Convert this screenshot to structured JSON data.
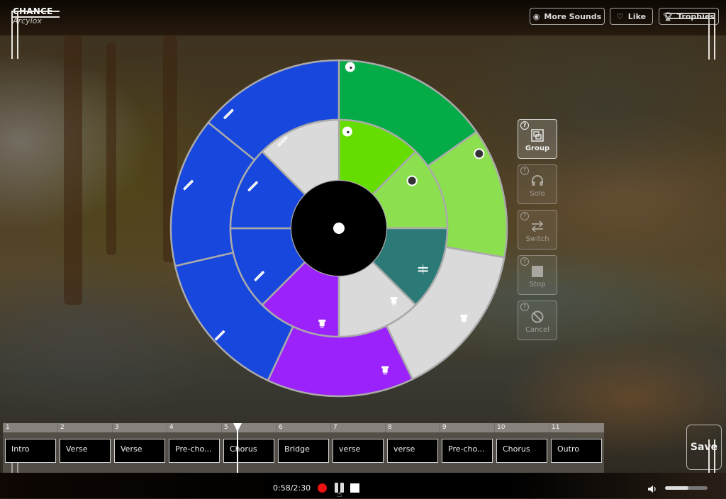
{
  "app": {
    "title": "CHANCE",
    "subtitle": "Arcylox"
  },
  "header": {
    "buttons": [
      {
        "label": "More Sounds",
        "icon": "disc-icon"
      },
      {
        "label": "Like",
        "icon": "heart-icon"
      },
      {
        "label": "Trophies",
        "icon": "trophy-icon"
      }
    ]
  },
  "wheel": {
    "hub_color": "#000000",
    "outer_ring": [
      {
        "start": 0,
        "end": 55,
        "color": "#04ab47",
        "icon": "dot-marker"
      },
      {
        "start": 55,
        "end": 100,
        "color": "#8ce050",
        "icon": "dark-dot-marker"
      },
      {
        "start": 100,
        "end": 154,
        "color": "#dadada",
        "icon": "bell-icon"
      },
      {
        "start": 154,
        "end": 205,
        "color": "#9b22fa",
        "icon": "bell-icon"
      },
      {
        "start": 205,
        "end": 257,
        "color": "#1747dd",
        "icon": "slash-icon"
      },
      {
        "start": 257,
        "end": 309,
        "color": "#1747dd",
        "icon": "slash-icon"
      },
      {
        "start": 309,
        "end": 360,
        "color": "#1747dd",
        "icon": "slash-icon"
      }
    ],
    "inner_ring": [
      {
        "start": 0,
        "end": 45,
        "color": "#66dd00",
        "icon": "dot-marker"
      },
      {
        "start": 45,
        "end": 90,
        "color": "#8ce050",
        "icon": "dark-dot-marker"
      },
      {
        "start": 90,
        "end": 135,
        "color": "#2b7a78",
        "icon": "equals-icon"
      },
      {
        "start": 135,
        "end": 180,
        "color": "#dadada",
        "icon": "bell-icon"
      },
      {
        "start": 180,
        "end": 225,
        "color": "#9b22fa",
        "icon": "bell-icon"
      },
      {
        "start": 225,
        "end": 270,
        "color": "#1747dd",
        "icon": "slash-icon"
      },
      {
        "start": 270,
        "end": 315,
        "color": "#1747dd",
        "icon": "slash-icon"
      },
      {
        "start": 315,
        "end": 360,
        "color": "#dadada",
        "icon": "slash-icon"
      }
    ]
  },
  "side_panel": {
    "buttons": [
      {
        "label": "Group",
        "icon": "group-icon",
        "active": true
      },
      {
        "label": "Solo",
        "icon": "headphones-icon",
        "active": false
      },
      {
        "label": "Switch",
        "icon": "switch-icon",
        "active": false
      },
      {
        "label": "Stop",
        "icon": "stop-icon",
        "active": false
      },
      {
        "label": "Cancel",
        "icon": "cancel-icon",
        "active": false
      }
    ],
    "help_glyph": "?"
  },
  "timeline": {
    "ticks": [
      "1",
      "2",
      "3",
      "4",
      "5",
      "6",
      "7",
      "8",
      "9",
      "10",
      "11"
    ],
    "sections": [
      "Intro",
      "Verse",
      "Verse",
      "Pre-cho...",
      "Chorus",
      "Bridge",
      "verse",
      "verse",
      "Pre-cho...",
      "Chorus",
      "Outro"
    ],
    "playhead_section": 5
  },
  "transport": {
    "time": "0:58/2:30",
    "record_color": "#ee1111",
    "volume": 0.55
  },
  "save_label": "Save"
}
